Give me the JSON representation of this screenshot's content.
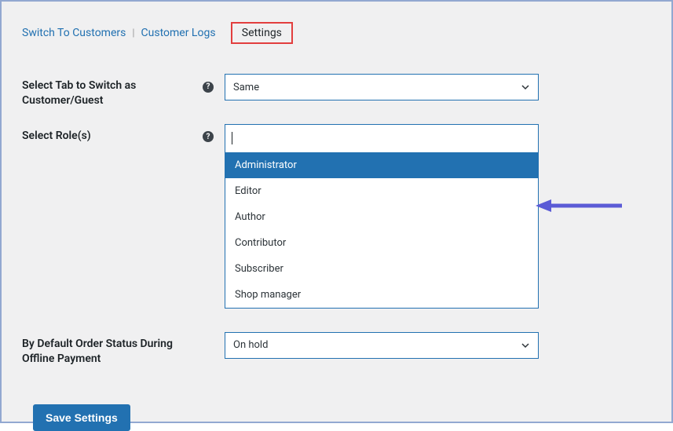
{
  "tabs": {
    "switch": "Switch To Customers",
    "logs": "Customer Logs",
    "settings": "Settings"
  },
  "labels": {
    "select_tab": "Select Tab to Switch as Customer/Guest",
    "select_roles": "Select Role(s)",
    "default_status": "By Default Order Status During Offline Payment"
  },
  "selects": {
    "tab_value": "Same",
    "status_value": "On hold"
  },
  "roles": {
    "input": "",
    "options": [
      "Administrator",
      "Editor",
      "Author",
      "Contributor",
      "Subscriber",
      "Shop manager"
    ],
    "highlighted_index": 0
  },
  "buttons": {
    "save": "Save Settings"
  },
  "colors": {
    "primary": "#2271b1",
    "link": "#2271b1",
    "frame": "#92a8d1",
    "highlight_red": "#e23e3e",
    "arrow": "#5b5bd6"
  }
}
